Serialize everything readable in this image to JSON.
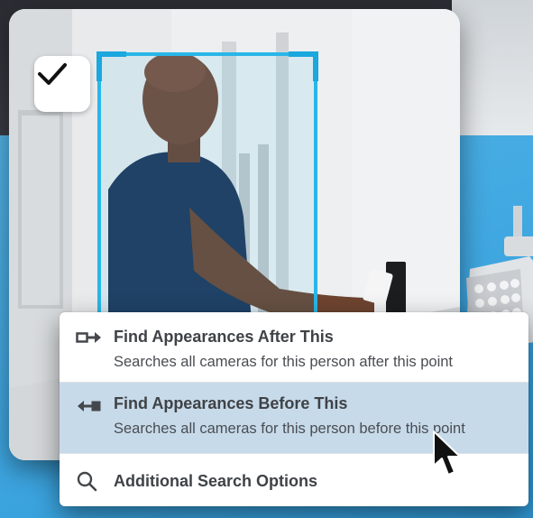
{
  "menu": {
    "items": [
      {
        "title": "Find Appearances After This",
        "subtitle": "Searches all cameras for this person after this point",
        "icon": "arrow-right-icon"
      },
      {
        "title": "Find Appearances Before This",
        "subtitle": "Searches all cameras for this person before this point",
        "icon": "arrow-left-icon",
        "highlighted": true
      },
      {
        "title": "Additional Search Options",
        "icon": "search-icon"
      }
    ]
  },
  "badge": {
    "icon": "checkmark-icon"
  },
  "detection_box": {
    "color": "#29b6e8"
  },
  "colors": {
    "highlight": "#c7daea",
    "background_blue": "#3ea6e0"
  }
}
